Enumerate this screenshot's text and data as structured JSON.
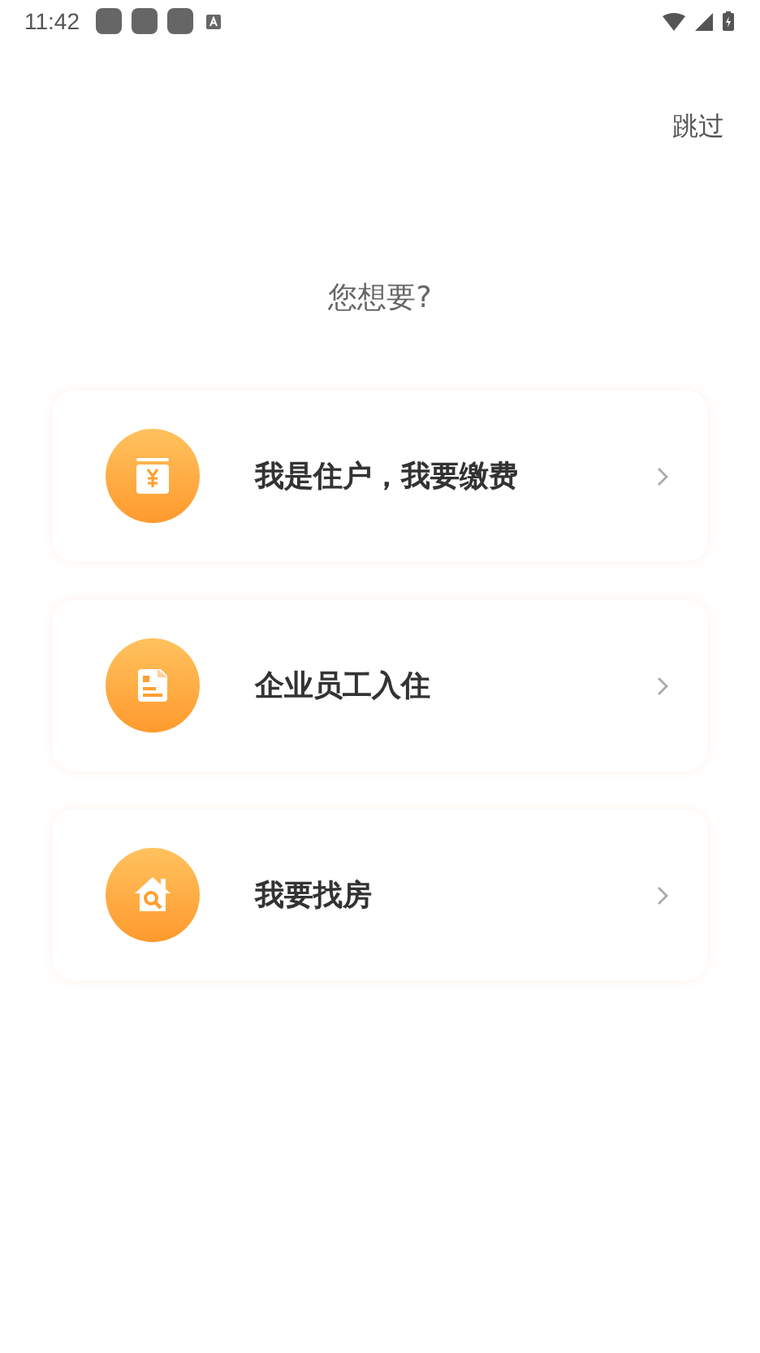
{
  "status_bar": {
    "time": "11:42"
  },
  "skip": "跳过",
  "question": "您想要?",
  "options": [
    {
      "kind": "bill",
      "label": "我是住户，我要缴费"
    },
    {
      "kind": "form",
      "label": "企业员工入住"
    },
    {
      "kind": "house",
      "label": "我要找房"
    }
  ]
}
